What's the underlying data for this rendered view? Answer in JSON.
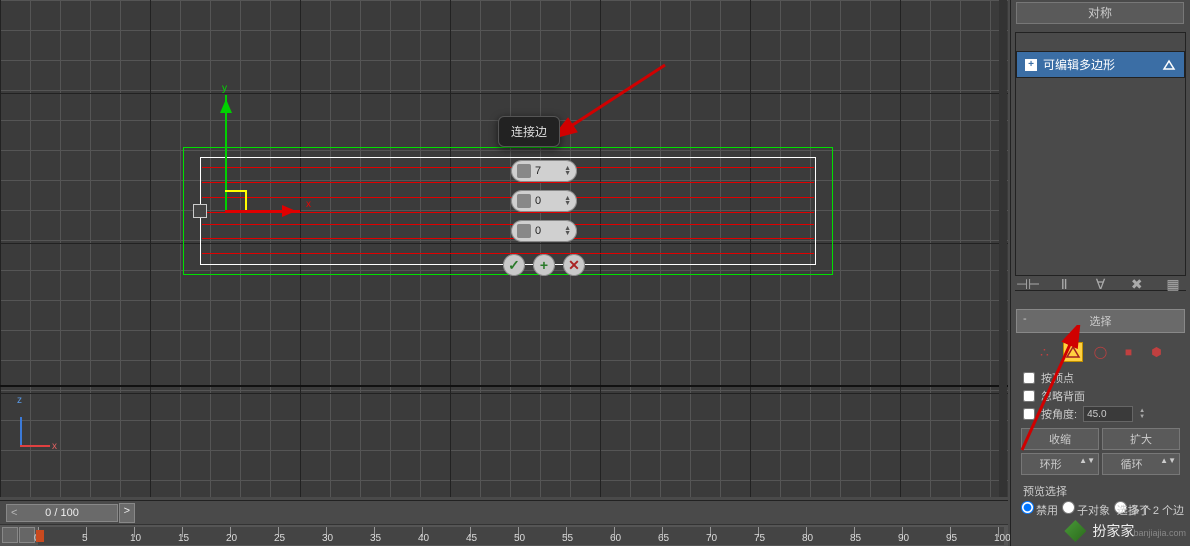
{
  "tooltip": {
    "label": "连接边"
  },
  "spinners": {
    "v1": "7",
    "v2": "0",
    "v3": "0"
  },
  "gizmo": {
    "x": "x",
    "y": "y"
  },
  "mini_axis": {
    "x": "x",
    "z": "z"
  },
  "timeline": {
    "pos": "0 / 100"
  },
  "ruler_marks": [
    "0",
    "5",
    "10",
    "15",
    "20",
    "25",
    "30",
    "35",
    "40",
    "45",
    "50",
    "55",
    "60",
    "65",
    "70",
    "75",
    "80",
    "85",
    "90",
    "95",
    "100"
  ],
  "top_button": "对称",
  "mod_stack": {
    "item": "可编辑多边形"
  },
  "selection": {
    "title": "选择",
    "by_vertex": "按顶点",
    "ignore_backface": "忽略背面",
    "by_angle": "按角度:",
    "angle_value": "45.0",
    "shrink": "收缩",
    "grow": "扩大",
    "ring": "环形",
    "loop": "循环",
    "preview": "预览选择",
    "disable": "禁用",
    "subobj": "子对象",
    "multi": "多个"
  },
  "status": "选择了 2 个边",
  "watermark": {
    "cn": "扮家家",
    "en": "banjiajia.com"
  }
}
